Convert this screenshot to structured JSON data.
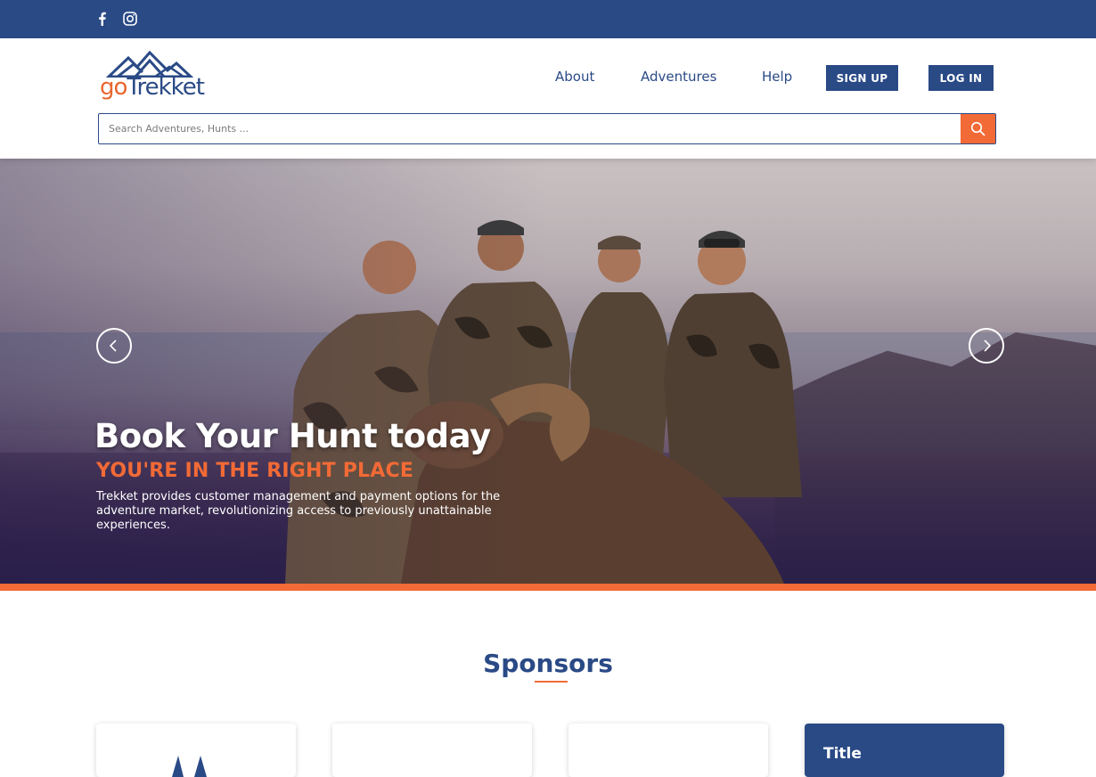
{
  "social": {
    "items": [
      {
        "icon": "facebook-icon"
      },
      {
        "icon": "instagram-icon"
      }
    ]
  },
  "header": {
    "logo": {
      "part1": "go",
      "part2": "Trekket"
    },
    "nav": {
      "about": "About",
      "adventures": "Adventures",
      "help": "Help"
    },
    "buttons": {
      "signup": "SIGN UP",
      "login": "LOG IN"
    },
    "search": {
      "placeholder": "Search Adventures, Hunts ..."
    }
  },
  "hero": {
    "title": "Book Your Hunt today",
    "subtitle": "YOU'RE IN THE RIGHT PLACE",
    "text": "Trekket provides customer management and payment options for the adventure market, revolutionizing access to previously unattainable experiences."
  },
  "sponsors": {
    "title": "Sponsors",
    "cards": [
      {
        "type": "logo"
      },
      {
        "type": "logo"
      },
      {
        "type": "logo"
      },
      {
        "title": "Title"
      }
    ]
  },
  "colors": {
    "primary": "#2a4a86",
    "accent": "#f26a36",
    "white": "#ffffff"
  }
}
